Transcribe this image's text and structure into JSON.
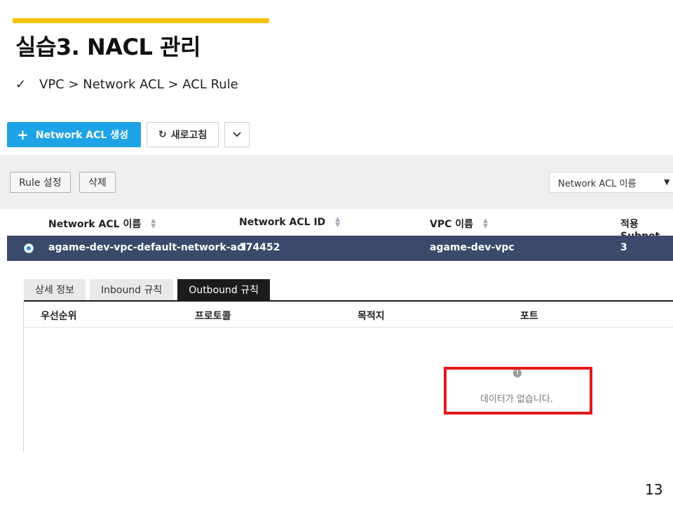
{
  "slide": {
    "title": "실습3. NACL 관리",
    "bullet_check": "✓",
    "bullet_path": "VPC > Network ACL > ACL Rule",
    "page_number": "13",
    "accent_color": "#f5c400"
  },
  "toolbar": {
    "create_icon": "+",
    "create_label": "Network ACL 생성",
    "refresh_icon": "↻",
    "refresh_label": "새로고침",
    "dropdown_icon": "chevron-down-icon"
  },
  "actions": {
    "rule_settings_label": "Rule 설정",
    "delete_label": "삭제",
    "filter_select_value": "Network ACL 이름",
    "filter_caret": "▼"
  },
  "acl_table": {
    "columns": [
      "Network ACL 이름",
      "Network ACL ID",
      "VPC 이름",
      "적용 Subnet"
    ],
    "selected_row": {
      "name": "agame-dev-vpc-default-network-acl",
      "id": "174452",
      "vpc": "agame-dev-vpc",
      "subnet_count": "3"
    },
    "selected_row_color": "#3b4a6b"
  },
  "detail_tabs": {
    "tabs": [
      "상세 정보",
      "Inbound 규칙",
      "Outbound 규칙"
    ],
    "active": "Outbound 규칙"
  },
  "rules_table": {
    "columns": [
      "우선순위",
      "프로토콜",
      "목적지",
      "포트"
    ],
    "empty_icon": "!",
    "empty_message": "데이터가 없습니다."
  },
  "colors": {
    "primary": "#1ea4e6",
    "highlight": "#e3191b"
  }
}
